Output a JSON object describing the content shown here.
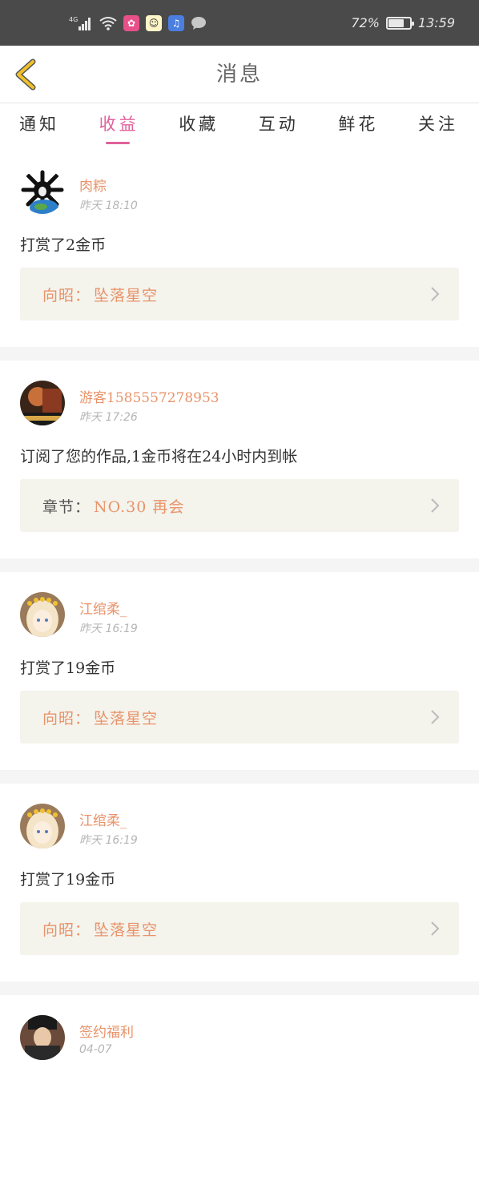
{
  "status_bar": {
    "network": "4G",
    "battery": "72%",
    "battery_level": 0.72,
    "time": "13:59"
  },
  "nav": {
    "title": "消息",
    "back_icon": "chevron-left-icon"
  },
  "tabs": [
    {
      "label": "通知",
      "active": false
    },
    {
      "label": "收益",
      "active": true
    },
    {
      "label": "收藏",
      "active": false
    },
    {
      "label": "互动",
      "active": false
    },
    {
      "label": "鲜花",
      "active": false
    },
    {
      "label": "关注",
      "active": false
    }
  ],
  "messages": [
    {
      "username": "肉粽",
      "time": "昨天 18:10",
      "text": "打赏了2金币",
      "ref_label": "向昭：",
      "ref_value": "坠落星空"
    },
    {
      "username": "游客1585557278953",
      "time": "昨天 17:26",
      "text": "订阅了您的作品,1金币将在24小时内到帐",
      "ref_label": "章节：",
      "ref_value": "NO.30 再会"
    },
    {
      "username": "江绾柔_",
      "time": "昨天 16:19",
      "text": "打赏了19金币",
      "ref_label": "向昭：",
      "ref_value": "坠落星空"
    },
    {
      "username": "江绾柔_",
      "time": "昨天 16:19",
      "text": "打赏了19金币",
      "ref_label": "向昭：",
      "ref_value": "坠落星空"
    },
    {
      "username": "签约福利",
      "time": "04-07",
      "text": "",
      "ref_label": "",
      "ref_value": ""
    }
  ],
  "colors": {
    "accent": "#e0609a",
    "username": "#e8936a",
    "back_icon": "#f0c02a",
    "ref_bg": "#f4f3ec"
  }
}
